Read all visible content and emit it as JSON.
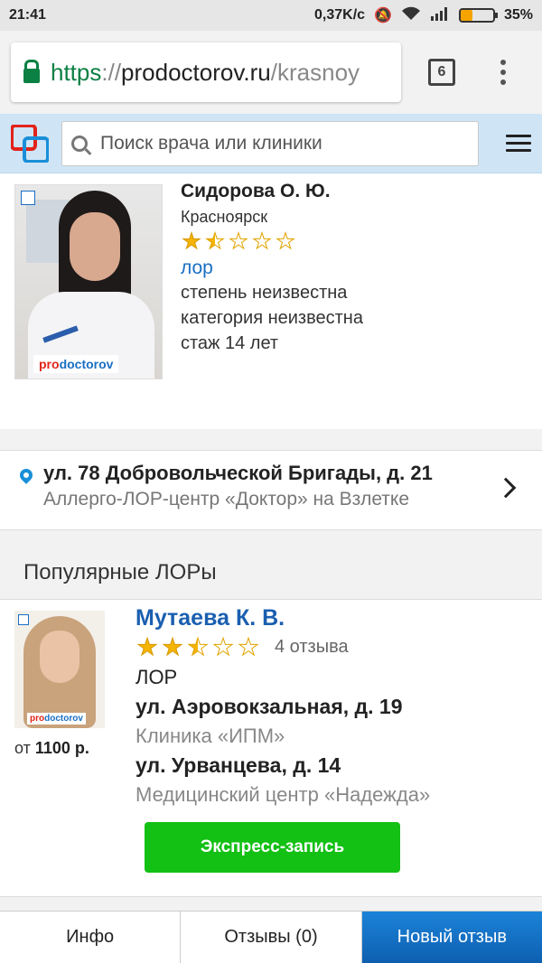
{
  "status_bar": {
    "time": "21:41",
    "network_speed": "0,37K/c",
    "battery": "35%",
    "battery_level": 0.35
  },
  "browser": {
    "url_scheme": "https",
    "url_sep": "://",
    "url_host": "prodoctorov.ru",
    "url_path": "/krasnoy",
    "tab_count": "6"
  },
  "header": {
    "search_placeholder": "Поиск врача или клиники"
  },
  "doctor": {
    "name": "Сидорова О. Ю.",
    "city": "Красноярск",
    "rating": 1.5,
    "specialty": "лор",
    "degree": "степень неизвестна",
    "category": "категория неизвестна",
    "experience": "стаж 14 лет",
    "photo_badge_pro": "pro",
    "photo_badge_doc": "doctorov"
  },
  "address": {
    "street": "ул. 78 Добровольческой Бригады, д. 21",
    "clinic": "Аллерго-ЛОР-центр «Доктор» на Взлетке"
  },
  "popular": {
    "title": "Популярные ЛОРы",
    "items": [
      {
        "name": "Мутаева К. В.",
        "rating": 2.5,
        "reviews": "4 отзыва",
        "specialty": "ЛОР",
        "price_prefix": "от",
        "price": "1100 р.",
        "address_1": "ул. Аэровокзальная, д. 19",
        "clinic_1": "Клиника «ИПМ»",
        "address_2": "ул. Урванцева, д. 14",
        "clinic_2": "Медицинский центр «Надежда»",
        "express_button": "Экспресс-запись",
        "photo_badge_pro": "pro",
        "photo_badge_doc": "doctorov"
      }
    ]
  },
  "bottom_tabs": [
    {
      "label": "Инфо"
    },
    {
      "label": "Отзывы (0)"
    },
    {
      "label": "Новый отзыв"
    }
  ],
  "colors": {
    "accent_blue": "#1a6fc4",
    "express_green": "#13c014",
    "star_gold": "#f5b400"
  }
}
